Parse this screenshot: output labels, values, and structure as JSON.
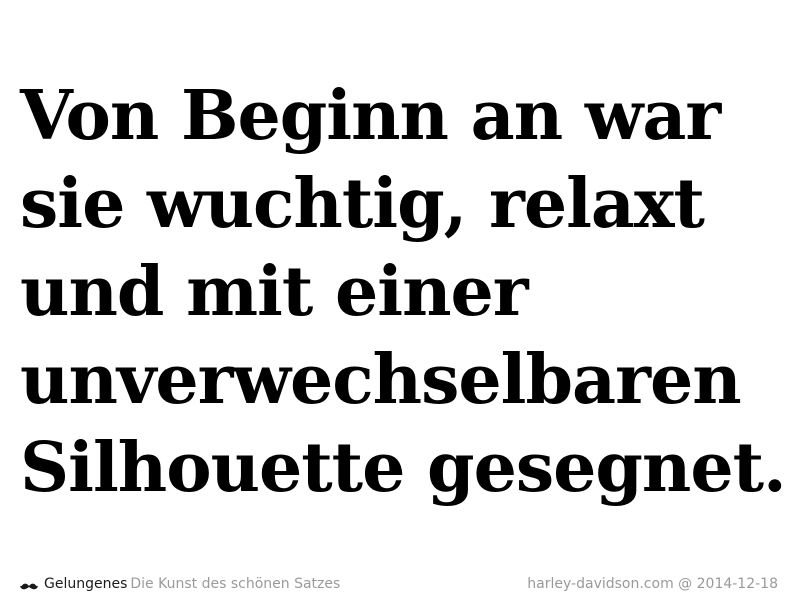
{
  "quote": {
    "lines": [
      "Von Beginn an war",
      "sie wuchtig, relaxt",
      "und mit einer",
      "unverwechselbaren",
      "Silhouette gesegnet."
    ]
  },
  "footer": {
    "icon": "mustache-icon",
    "brand": "Gelungenes",
    "tagline": "Die Kunst des schönen Satzes",
    "source": "harley-davidson.com",
    "separator": "@",
    "date": "2014-12-18"
  }
}
